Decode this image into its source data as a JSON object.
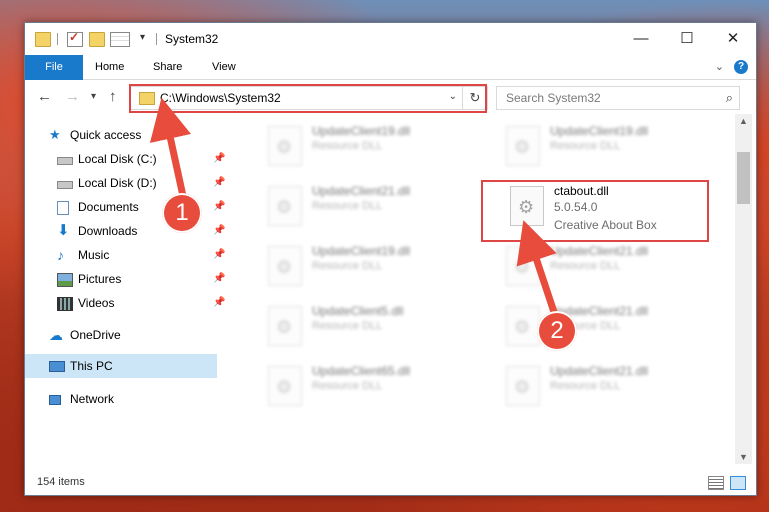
{
  "window": {
    "title": "System32",
    "controls": {
      "minimize": "—",
      "maximize": "☐",
      "close": "✕"
    }
  },
  "ribbon": {
    "tabs": [
      "File",
      "Home",
      "Share",
      "View"
    ],
    "help": "?"
  },
  "address_bar": {
    "path": "C:\\Windows\\System32"
  },
  "search": {
    "placeholder": "Search System32"
  },
  "sidebar": {
    "items": [
      {
        "label": "Quick access",
        "icon": "star-icon"
      },
      {
        "label": "Local Disk (C:)",
        "icon": "drive-icon",
        "pinned": true
      },
      {
        "label": "Local Disk (D:)",
        "icon": "drive-icon",
        "pinned": true
      },
      {
        "label": "Documents",
        "icon": "documents-icon",
        "pinned": true
      },
      {
        "label": "Downloads",
        "icon": "download-icon",
        "pinned": true
      },
      {
        "label": "Music",
        "icon": "music-icon",
        "pinned": true
      },
      {
        "label": "Pictures",
        "icon": "pictures-icon",
        "pinned": true
      },
      {
        "label": "Videos",
        "icon": "videos-icon",
        "pinned": true
      },
      {
        "label": "OneDrive",
        "icon": "cloud-icon"
      },
      {
        "label": "This PC",
        "icon": "computer-icon",
        "selected": true
      },
      {
        "label": "Network",
        "icon": "network-icon"
      }
    ]
  },
  "files": [
    {
      "name": "UpdateClient19.dll",
      "type": "Resource DLL"
    },
    {
      "name": "UpdateClient19.dll",
      "type": "Resource DLL"
    },
    {
      "name": "UpdateClient21.dll",
      "type": "Resource DLL"
    },
    {
      "name": "ctabout.dll",
      "version": "5.0.54.0",
      "description": "Creative About Box"
    },
    {
      "name": "UpdateClient19.dll",
      "type": "Resource DLL"
    },
    {
      "name": "UpdateClient21.dll",
      "type": "Resource DLL"
    },
    {
      "name": "UpdateClient5.dll",
      "type": "Resource DLL"
    },
    {
      "name": "UpdateClient21.dll",
      "type": "Resource DLL"
    },
    {
      "name": "UpdateClient65.dll",
      "type": "Resource DLL"
    },
    {
      "name": "UpdateClient21.dll",
      "type": "Resource DLL"
    }
  ],
  "status": {
    "items": "154 items"
  },
  "callouts": [
    "1",
    "2"
  ],
  "colors": {
    "accent": "#1979ca",
    "highlight": "#e04545",
    "badge": "#e74c3c",
    "selection": "#cde6f7"
  }
}
